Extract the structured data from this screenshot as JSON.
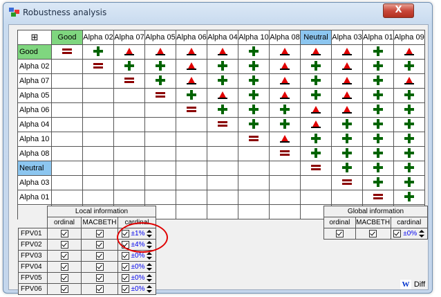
{
  "window": {
    "title": "Robustness analysis",
    "close_label": "X"
  },
  "matrix": {
    "corner_icon": "grid-icon",
    "columns": [
      {
        "label": "Good",
        "highlight": "green"
      },
      {
        "label": "Alpha 02",
        "highlight": ""
      },
      {
        "label": "Alpha 07",
        "highlight": ""
      },
      {
        "label": "Alpha 05",
        "highlight": ""
      },
      {
        "label": "Alpha 06",
        "highlight": ""
      },
      {
        "label": "Alpha 04",
        "highlight": ""
      },
      {
        "label": "Alpha 10",
        "highlight": ""
      },
      {
        "label": "Alpha 08",
        "highlight": ""
      },
      {
        "label": "Neutral",
        "highlight": "blue"
      },
      {
        "label": "Alpha 03",
        "highlight": ""
      },
      {
        "label": "Alpha 01",
        "highlight": ""
      },
      {
        "label": "Alpha 09",
        "highlight": ""
      }
    ],
    "rows": [
      {
        "label": "Good",
        "highlight": "green",
        "cells": [
          "=",
          "+",
          "^",
          "^",
          "^",
          "^",
          "+",
          "^",
          "^",
          "^",
          "+",
          "^"
        ]
      },
      {
        "label": "Alpha 02",
        "highlight": "",
        "cells": [
          "",
          "=",
          "+",
          "+",
          "^",
          "+",
          "+",
          "^",
          "+",
          "^",
          "+",
          "+"
        ]
      },
      {
        "label": "Alpha 07",
        "highlight": "",
        "cells": [
          "",
          "",
          "=",
          "+",
          "^",
          "+",
          "+",
          "^",
          "+",
          "^",
          "+",
          "^"
        ]
      },
      {
        "label": "Alpha 05",
        "highlight": "",
        "cells": [
          "",
          "",
          "",
          "=",
          "+",
          "^",
          "+",
          "^",
          "+",
          "^",
          "+",
          "+"
        ]
      },
      {
        "label": "Alpha 06",
        "highlight": "",
        "cells": [
          "",
          "",
          "",
          "",
          "=",
          "+",
          "+",
          "+",
          "^",
          "^",
          "+",
          "+"
        ]
      },
      {
        "label": "Alpha 04",
        "highlight": "",
        "cells": [
          "",
          "",
          "",
          "",
          "",
          "=",
          "+",
          "+",
          "^",
          "+",
          "+",
          "+"
        ]
      },
      {
        "label": "Alpha 10",
        "highlight": "",
        "cells": [
          "",
          "",
          "",
          "",
          "",
          "",
          "=",
          "^",
          "+",
          "+",
          "+",
          "+"
        ]
      },
      {
        "label": "Alpha 08",
        "highlight": "",
        "cells": [
          "",
          "",
          "",
          "",
          "",
          "",
          "",
          "=",
          "+",
          "+",
          "+",
          "+"
        ]
      },
      {
        "label": "Neutral",
        "highlight": "blue",
        "cells": [
          "",
          "",
          "",
          "",
          "",
          "",
          "",
          "",
          "=",
          "+",
          "+",
          "+"
        ]
      },
      {
        "label": "Alpha 03",
        "highlight": "",
        "cells": [
          "",
          "",
          "",
          "",
          "",
          "",
          "",
          "",
          "",
          "=",
          "+",
          "+"
        ]
      },
      {
        "label": "Alpha 01",
        "highlight": "",
        "cells": [
          "",
          "",
          "",
          "",
          "",
          "",
          "",
          "",
          "",
          "",
          "=",
          "+"
        ]
      },
      {
        "label": "Alpha 09",
        "highlight": "",
        "cells": [
          "",
          "",
          "",
          "",
          "",
          "",
          "",
          "",
          "",
          "",
          "",
          "="
        ]
      }
    ]
  },
  "local_info": {
    "title": "Local information",
    "columns": [
      "ordinal",
      "MACBETH",
      "cardinal"
    ],
    "rows": [
      {
        "name": "FPV01",
        "ordinal": true,
        "macbeth": true,
        "cardinal": true,
        "value": "±1%"
      },
      {
        "name": "FPV02",
        "ordinal": true,
        "macbeth": true,
        "cardinal": true,
        "value": "±4%"
      },
      {
        "name": "FPV03",
        "ordinal": true,
        "macbeth": true,
        "cardinal": true,
        "value": "±0%"
      },
      {
        "name": "FPV04",
        "ordinal": true,
        "macbeth": true,
        "cardinal": true,
        "value": "±0%"
      },
      {
        "name": "FPV05",
        "ordinal": true,
        "macbeth": true,
        "cardinal": true,
        "value": "±0%"
      },
      {
        "name": "FPV06",
        "ordinal": true,
        "macbeth": true,
        "cardinal": true,
        "value": "±0%"
      }
    ]
  },
  "global_info": {
    "title": "Global information",
    "columns": [
      "ordinal",
      "MACBETH",
      "cardinal"
    ],
    "value": "±0%"
  },
  "footer": {
    "diff_icon_label": "W",
    "diff_label": "Diff"
  },
  "colors": {
    "green_header": "#7fd67f",
    "blue_header": "#8cc6f0",
    "plus": "#006400",
    "triangle": "#e00000",
    "equal": "#8b0000"
  }
}
